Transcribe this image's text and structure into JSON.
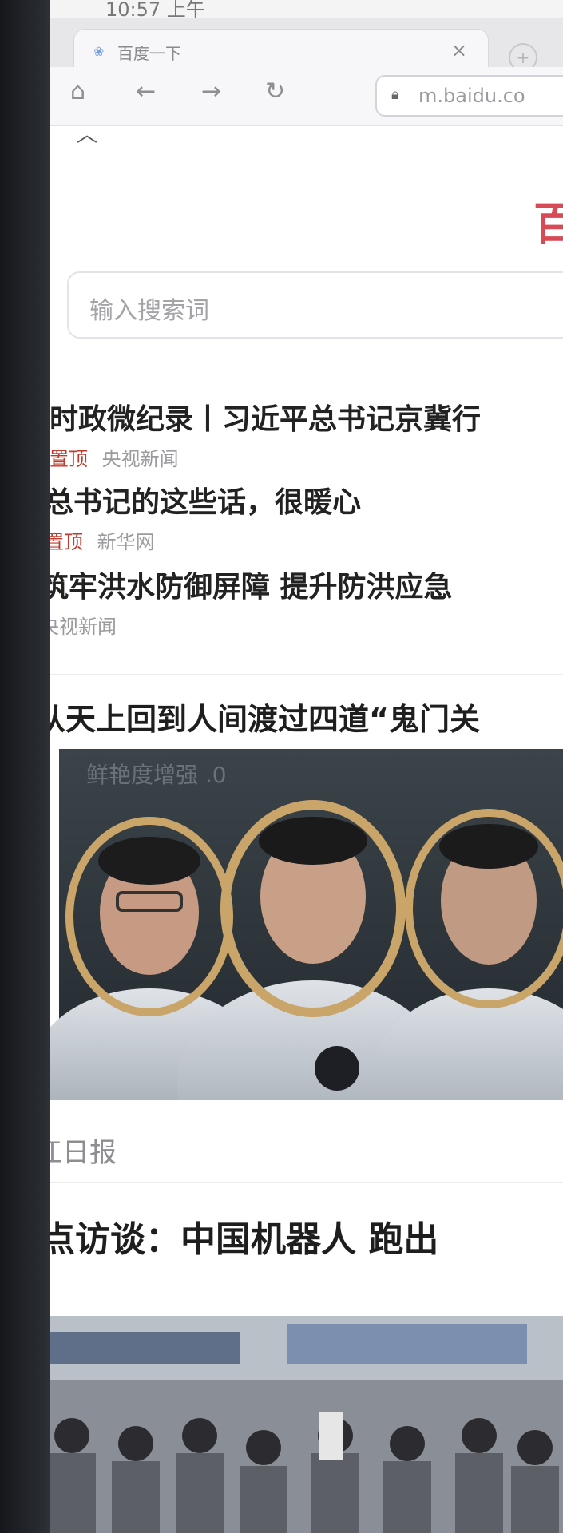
{
  "status": {
    "time": "10:57 上午"
  },
  "browser": {
    "tab_title": "百度一下",
    "url": "m.baidu.co"
  },
  "search": {
    "placeholder": "输入搜索词"
  },
  "hot_news": [
    {
      "title": "时政微纪录丨习近平总书记京冀行",
      "tag": "置顶",
      "source": "央视新闻"
    },
    {
      "title": "总书记的这些话，很暖心",
      "tag": "置顶",
      "source": "新华网"
    },
    {
      "title": "筑牢洪水防御屏障 提升防洪应急",
      "tag": "",
      "source": "央视新闻"
    }
  ],
  "feed": [
    {
      "title": "从天上回到人间渡过四道“鬼门关",
      "source": "浙江日报",
      "image_caption": "鲜艳度增强 .0"
    },
    {
      "title": "焦点访谈：中国机器人 跑出",
      "source": ""
    }
  ],
  "colors": {
    "accent": "#c0392b",
    "logo": "#d84a55"
  }
}
